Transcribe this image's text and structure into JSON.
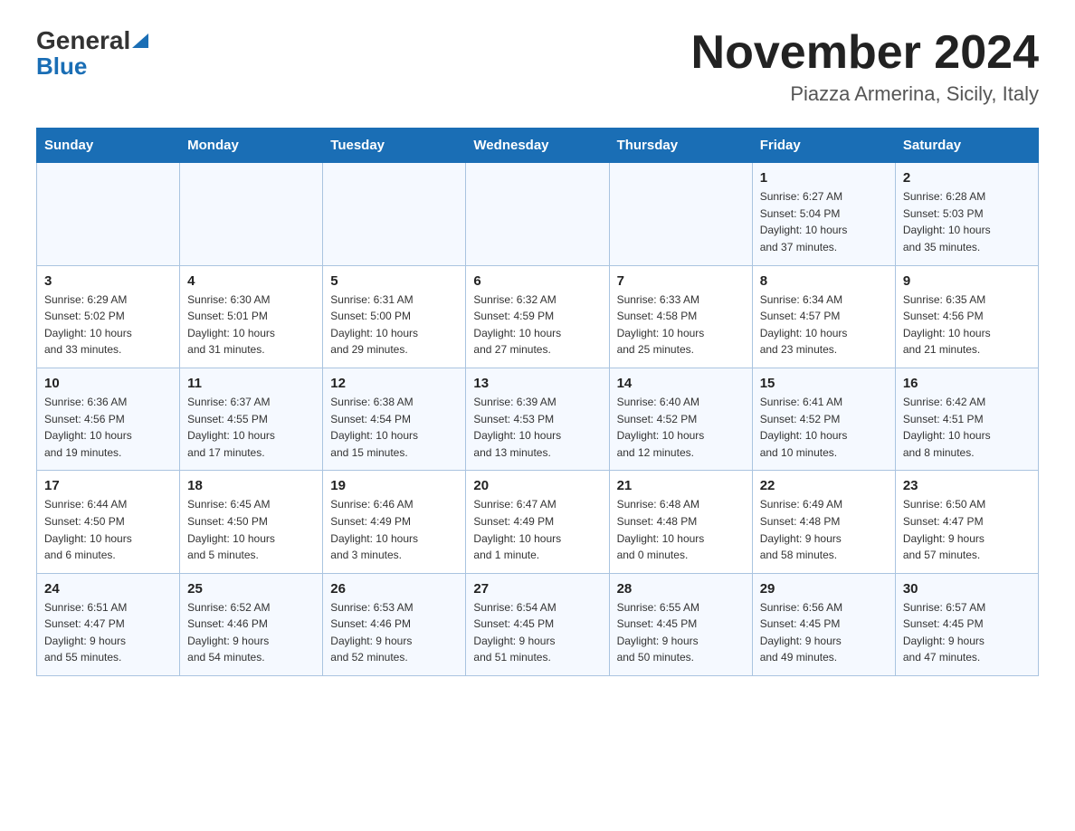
{
  "header": {
    "logo_general": "General",
    "logo_blue": "Blue",
    "title": "November 2024",
    "subtitle": "Piazza Armerina, Sicily, Italy"
  },
  "calendar": {
    "weekdays": [
      "Sunday",
      "Monday",
      "Tuesday",
      "Wednesday",
      "Thursday",
      "Friday",
      "Saturday"
    ],
    "rows": [
      [
        {
          "day": "",
          "info": ""
        },
        {
          "day": "",
          "info": ""
        },
        {
          "day": "",
          "info": ""
        },
        {
          "day": "",
          "info": ""
        },
        {
          "day": "",
          "info": ""
        },
        {
          "day": "1",
          "info": "Sunrise: 6:27 AM\nSunset: 5:04 PM\nDaylight: 10 hours\nand 37 minutes."
        },
        {
          "day": "2",
          "info": "Sunrise: 6:28 AM\nSunset: 5:03 PM\nDaylight: 10 hours\nand 35 minutes."
        }
      ],
      [
        {
          "day": "3",
          "info": "Sunrise: 6:29 AM\nSunset: 5:02 PM\nDaylight: 10 hours\nand 33 minutes."
        },
        {
          "day": "4",
          "info": "Sunrise: 6:30 AM\nSunset: 5:01 PM\nDaylight: 10 hours\nand 31 minutes."
        },
        {
          "day": "5",
          "info": "Sunrise: 6:31 AM\nSunset: 5:00 PM\nDaylight: 10 hours\nand 29 minutes."
        },
        {
          "day": "6",
          "info": "Sunrise: 6:32 AM\nSunset: 4:59 PM\nDaylight: 10 hours\nand 27 minutes."
        },
        {
          "day": "7",
          "info": "Sunrise: 6:33 AM\nSunset: 4:58 PM\nDaylight: 10 hours\nand 25 minutes."
        },
        {
          "day": "8",
          "info": "Sunrise: 6:34 AM\nSunset: 4:57 PM\nDaylight: 10 hours\nand 23 minutes."
        },
        {
          "day": "9",
          "info": "Sunrise: 6:35 AM\nSunset: 4:56 PM\nDaylight: 10 hours\nand 21 minutes."
        }
      ],
      [
        {
          "day": "10",
          "info": "Sunrise: 6:36 AM\nSunset: 4:56 PM\nDaylight: 10 hours\nand 19 minutes."
        },
        {
          "day": "11",
          "info": "Sunrise: 6:37 AM\nSunset: 4:55 PM\nDaylight: 10 hours\nand 17 minutes."
        },
        {
          "day": "12",
          "info": "Sunrise: 6:38 AM\nSunset: 4:54 PM\nDaylight: 10 hours\nand 15 minutes."
        },
        {
          "day": "13",
          "info": "Sunrise: 6:39 AM\nSunset: 4:53 PM\nDaylight: 10 hours\nand 13 minutes."
        },
        {
          "day": "14",
          "info": "Sunrise: 6:40 AM\nSunset: 4:52 PM\nDaylight: 10 hours\nand 12 minutes."
        },
        {
          "day": "15",
          "info": "Sunrise: 6:41 AM\nSunset: 4:52 PM\nDaylight: 10 hours\nand 10 minutes."
        },
        {
          "day": "16",
          "info": "Sunrise: 6:42 AM\nSunset: 4:51 PM\nDaylight: 10 hours\nand 8 minutes."
        }
      ],
      [
        {
          "day": "17",
          "info": "Sunrise: 6:44 AM\nSunset: 4:50 PM\nDaylight: 10 hours\nand 6 minutes."
        },
        {
          "day": "18",
          "info": "Sunrise: 6:45 AM\nSunset: 4:50 PM\nDaylight: 10 hours\nand 5 minutes."
        },
        {
          "day": "19",
          "info": "Sunrise: 6:46 AM\nSunset: 4:49 PM\nDaylight: 10 hours\nand 3 minutes."
        },
        {
          "day": "20",
          "info": "Sunrise: 6:47 AM\nSunset: 4:49 PM\nDaylight: 10 hours\nand 1 minute."
        },
        {
          "day": "21",
          "info": "Sunrise: 6:48 AM\nSunset: 4:48 PM\nDaylight: 10 hours\nand 0 minutes."
        },
        {
          "day": "22",
          "info": "Sunrise: 6:49 AM\nSunset: 4:48 PM\nDaylight: 9 hours\nand 58 minutes."
        },
        {
          "day": "23",
          "info": "Sunrise: 6:50 AM\nSunset: 4:47 PM\nDaylight: 9 hours\nand 57 minutes."
        }
      ],
      [
        {
          "day": "24",
          "info": "Sunrise: 6:51 AM\nSunset: 4:47 PM\nDaylight: 9 hours\nand 55 minutes."
        },
        {
          "day": "25",
          "info": "Sunrise: 6:52 AM\nSunset: 4:46 PM\nDaylight: 9 hours\nand 54 minutes."
        },
        {
          "day": "26",
          "info": "Sunrise: 6:53 AM\nSunset: 4:46 PM\nDaylight: 9 hours\nand 52 minutes."
        },
        {
          "day": "27",
          "info": "Sunrise: 6:54 AM\nSunset: 4:45 PM\nDaylight: 9 hours\nand 51 minutes."
        },
        {
          "day": "28",
          "info": "Sunrise: 6:55 AM\nSunset: 4:45 PM\nDaylight: 9 hours\nand 50 minutes."
        },
        {
          "day": "29",
          "info": "Sunrise: 6:56 AM\nSunset: 4:45 PM\nDaylight: 9 hours\nand 49 minutes."
        },
        {
          "day": "30",
          "info": "Sunrise: 6:57 AM\nSunset: 4:45 PM\nDaylight: 9 hours\nand 47 minutes."
        }
      ]
    ]
  }
}
